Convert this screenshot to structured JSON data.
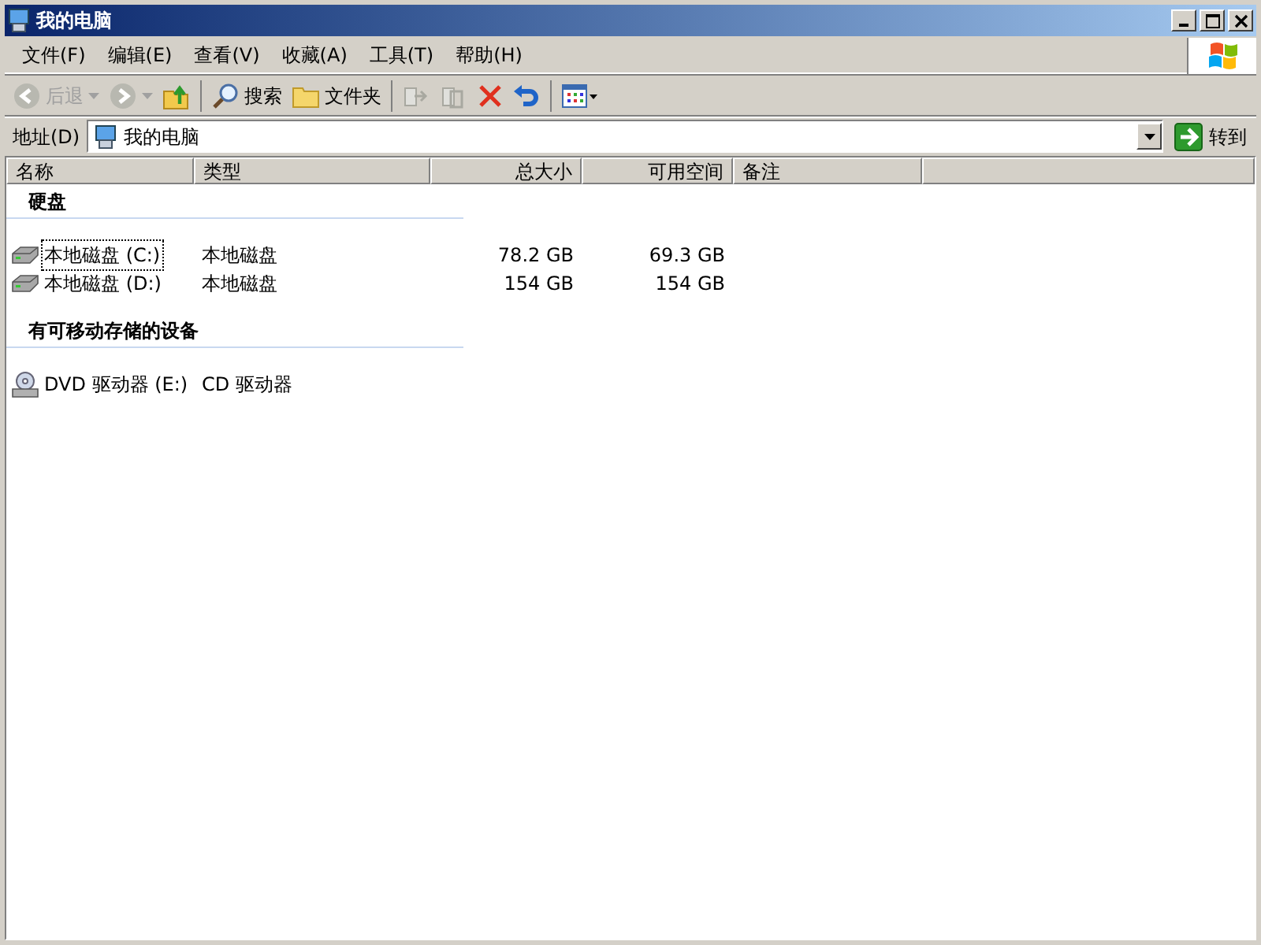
{
  "window": {
    "title": "我的电脑"
  },
  "menu": [
    "文件(F)",
    "编辑(E)",
    "查看(V)",
    "收藏(A)",
    "工具(T)",
    "帮助(H)"
  ],
  "toolbar": [
    {
      "kind": "back",
      "label": "后退",
      "disabled": true
    },
    {
      "kind": "forward",
      "disabled": true
    },
    {
      "kind": "up",
      "disabled": false
    },
    {
      "kind": "search",
      "label": "搜索",
      "disabled": false
    },
    {
      "kind": "folders",
      "label": "文件夹",
      "disabled": false
    },
    {
      "kind": "move",
      "disabled": true
    },
    {
      "kind": "copy",
      "disabled": true
    },
    {
      "kind": "delete",
      "disabled": false
    },
    {
      "kind": "undo",
      "disabled": false
    },
    {
      "kind": "views",
      "disabled": false
    }
  ],
  "address": {
    "label": "地址(D)",
    "value": "我的电脑",
    "go": "转到"
  },
  "columns": [
    "名称",
    "类型",
    "总大小",
    "可用空间",
    "备注"
  ],
  "groups": [
    {
      "title": "硬盘",
      "items": [
        {
          "kind": "disk",
          "name": "本地磁盘 (C:)",
          "type": "本地磁盘",
          "total": "78.2 GB",
          "free": "69.3 GB",
          "focused": true
        },
        {
          "kind": "disk",
          "name": "本地磁盘 (D:)",
          "type": "本地磁盘",
          "total": "154 GB",
          "free": "154 GB",
          "focused": false
        }
      ]
    },
    {
      "title": "有可移动存储的设备",
      "items": [
        {
          "kind": "dvd",
          "name": "DVD 驱动器 (E:)",
          "type": "CD 驱动器",
          "focused": false
        }
      ]
    }
  ]
}
